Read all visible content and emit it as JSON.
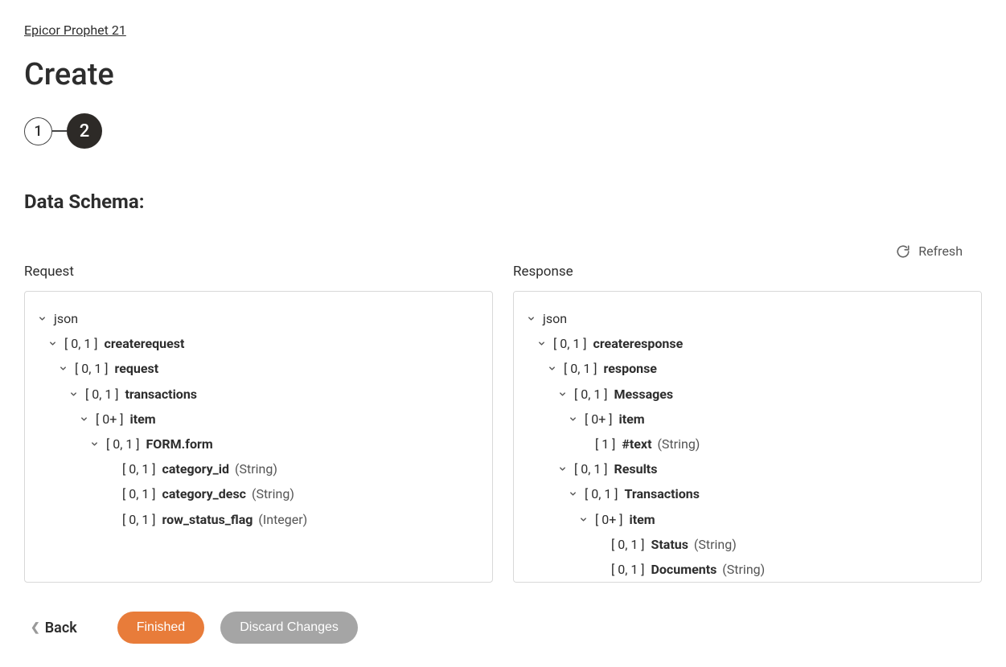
{
  "breadcrumb": "Epicor Prophet 21",
  "page_title": "Create",
  "stepper": {
    "step1": "1",
    "step2": "2"
  },
  "section_heading": "Data Schema:",
  "refresh_label": "Refresh",
  "panel_labels": {
    "request": "Request",
    "response": "Response"
  },
  "request_tree": [
    {
      "depth": 0,
      "chev": true,
      "card": "",
      "name": "json",
      "bold": false,
      "type": ""
    },
    {
      "depth": 1,
      "chev": true,
      "card": "[ 0, 1 ]",
      "name": "createrequest",
      "bold": true,
      "type": ""
    },
    {
      "depth": 2,
      "chev": true,
      "card": "[ 0, 1 ]",
      "name": "request",
      "bold": true,
      "type": ""
    },
    {
      "depth": 3,
      "chev": true,
      "card": "[ 0, 1 ]",
      "name": "transactions",
      "bold": true,
      "type": ""
    },
    {
      "depth": 4,
      "chev": true,
      "card": "[ 0+ ]",
      "name": "item",
      "bold": true,
      "type": ""
    },
    {
      "depth": 5,
      "chev": true,
      "card": "[ 0, 1 ]",
      "name": "FORM.form",
      "bold": true,
      "type": ""
    },
    {
      "depth": 6,
      "chev": false,
      "card": "[ 0, 1 ]",
      "name": "category_id",
      "bold": true,
      "type": "(String)"
    },
    {
      "depth": 6,
      "chev": false,
      "card": "[ 0, 1 ]",
      "name": "category_desc",
      "bold": true,
      "type": "(String)"
    },
    {
      "depth": 6,
      "chev": false,
      "card": "[ 0, 1 ]",
      "name": "row_status_flag",
      "bold": true,
      "type": "(Integer)"
    }
  ],
  "response_tree": [
    {
      "depth": 0,
      "chev": true,
      "card": "",
      "name": "json",
      "bold": false,
      "type": ""
    },
    {
      "depth": 1,
      "chev": true,
      "card": "[ 0, 1 ]",
      "name": "createresponse",
      "bold": true,
      "type": ""
    },
    {
      "depth": 2,
      "chev": true,
      "card": "[ 0, 1 ]",
      "name": "response",
      "bold": true,
      "type": ""
    },
    {
      "depth": 3,
      "chev": true,
      "card": "[ 0, 1 ]",
      "name": "Messages",
      "bold": true,
      "type": ""
    },
    {
      "depth": 4,
      "chev": true,
      "card": "[ 0+ ]",
      "name": "item",
      "bold": true,
      "type": ""
    },
    {
      "depth": 5,
      "chev": false,
      "card": "[ 1 ]",
      "name": "#text",
      "bold": true,
      "type": "(String)"
    },
    {
      "depth": 3,
      "chev": true,
      "card": "[ 0, 1 ]",
      "name": "Results",
      "bold": true,
      "type": ""
    },
    {
      "depth": 4,
      "chev": true,
      "card": "[ 0, 1 ]",
      "name": "Transactions",
      "bold": true,
      "type": ""
    },
    {
      "depth": 5,
      "chev": true,
      "card": "[ 0+ ]",
      "name": "item",
      "bold": true,
      "type": ""
    },
    {
      "depth": 6,
      "chev": false,
      "card": "[ 0, 1 ]",
      "name": "Status",
      "bold": true,
      "type": "(String)"
    },
    {
      "depth": 6,
      "chev": false,
      "card": "[ 0, 1 ]",
      "name": "Documents",
      "bold": true,
      "type": "(String)"
    }
  ],
  "actions": {
    "back": "Back",
    "finished": "Finished",
    "discard": "Discard Changes"
  }
}
